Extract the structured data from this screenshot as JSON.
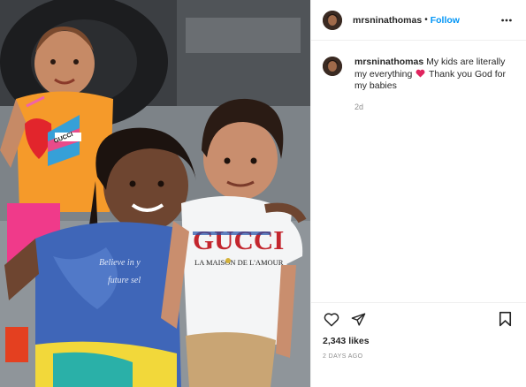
{
  "post": {
    "username": "mrsninathomas",
    "follow_label": "Follow",
    "header_separator": "•"
  },
  "caption": {
    "username": "mrsninathomas",
    "text_before_emoji": "My kids are literally my everything",
    "emoji": "red-heart",
    "text_after_emoji": "Thank you God for my babies",
    "time": "2d"
  },
  "photo": {
    "shirt_print_brand": "GUCCI",
    "shirt_print_sub": "LA MAISON DE L'AMOUR",
    "left_shirt_print": "GUCCI",
    "middle_shirt_print": "Believe in y",
    "middle_shirt_print_2": "future sel"
  },
  "engagement": {
    "likes": "2,343 likes",
    "date": "2 DAYS AGO"
  },
  "icons": {
    "like": "heart-outline-icon",
    "share": "paper-plane-icon",
    "save": "bookmark-icon",
    "more": "three-dots-icon"
  },
  "colors": {
    "follow_blue": "#0095f6",
    "meta_gray": "#8e8e8e",
    "text": "#262626",
    "heart_red": "#e0245e"
  }
}
